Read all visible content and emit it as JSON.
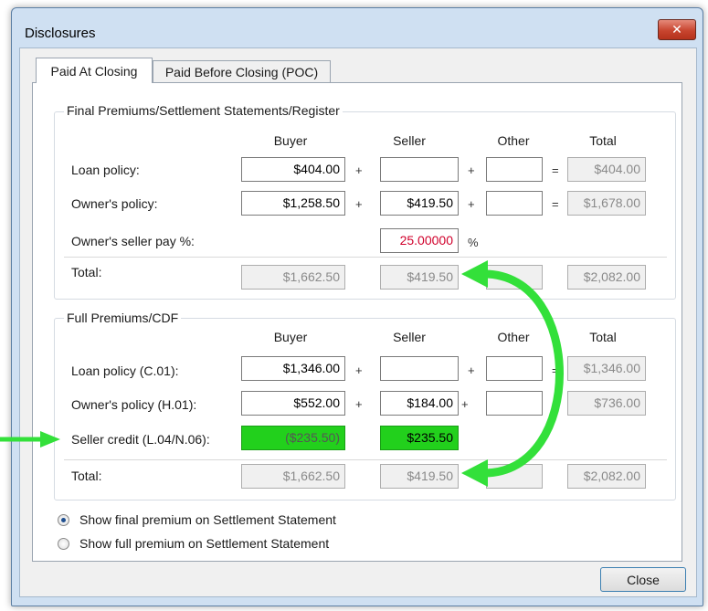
{
  "window": {
    "title": "Disclosures",
    "close_glyph": "✕"
  },
  "tabs": [
    {
      "label": "Paid At Closing",
      "active": true
    },
    {
      "label": "Paid Before Closing (POC)",
      "active": false
    }
  ],
  "columns": {
    "buyer": "Buyer",
    "seller": "Seller",
    "other": "Other",
    "total": "Total"
  },
  "operators": {
    "plus": "+",
    "equals": "=",
    "percent": "%"
  },
  "final": {
    "title": "Final Premiums/Settlement Statements/Register",
    "loan": {
      "label": "Loan policy:",
      "buyer": "$404.00",
      "seller": "",
      "other": "",
      "total": "$404.00"
    },
    "owner": {
      "label": "Owner's policy:",
      "buyer": "$1,258.50",
      "seller": "$419.50",
      "other": "",
      "total": "$1,678.00"
    },
    "pay_pct": {
      "label": "Owner's seller pay %:",
      "value": "25.00000"
    },
    "total": {
      "label": "Total:",
      "buyer": "$1,662.50",
      "seller": "$419.50",
      "other": "",
      "total": "$2,082.00"
    }
  },
  "full": {
    "title": "Full Premiums/CDF",
    "loan": {
      "label": "Loan policy (C.01):",
      "buyer": "$1,346.00",
      "seller": "",
      "other": "",
      "total": "$1,346.00"
    },
    "owner": {
      "label": "Owner's policy (H.01):",
      "buyer": "$552.00",
      "seller": "$184.00",
      "other": "",
      "total": "$736.00"
    },
    "credit": {
      "label": "Seller credit (L.04/N.06):",
      "buyer": "($235.50)",
      "seller": "$235.50"
    },
    "total": {
      "label": "Total:",
      "buyer": "$1,662.50",
      "seller": "$419.50",
      "other": "",
      "total": "$2,082.00"
    }
  },
  "options": [
    {
      "label": "Show final premium on Settlement Statement",
      "selected": true
    },
    {
      "label": "Show full premium on Settlement Statement",
      "selected": false
    }
  ],
  "close_label": "Close",
  "colors": {
    "highlight_green": "#22d01c",
    "annotation_arrow": "#33e03a",
    "red_value": "#d0002b"
  }
}
